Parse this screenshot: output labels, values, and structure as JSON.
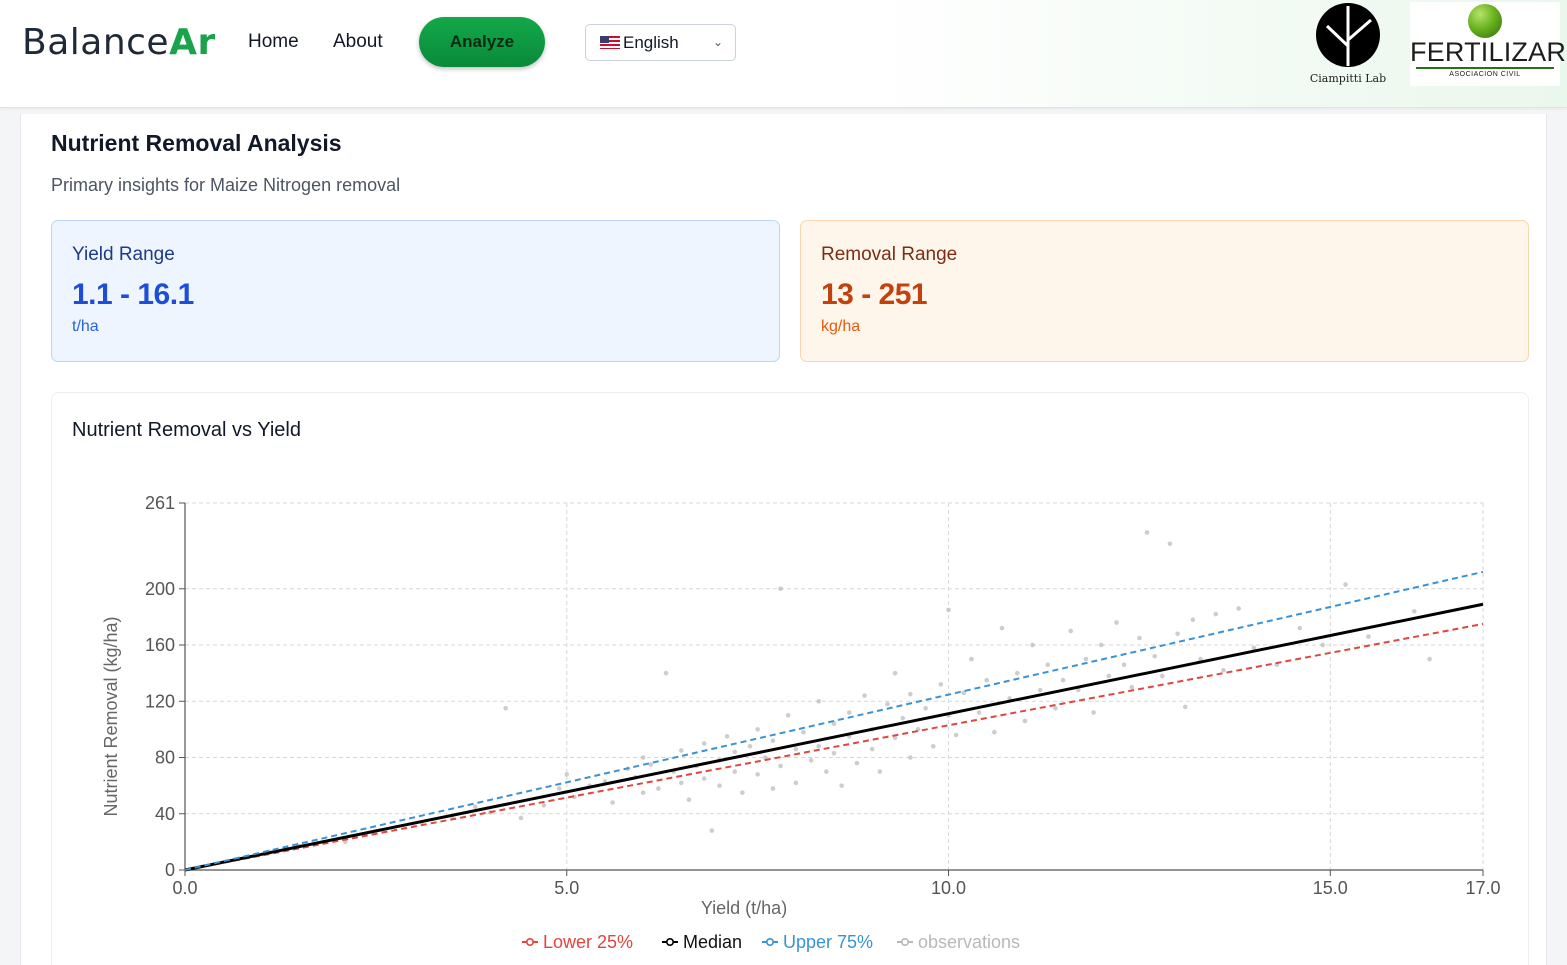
{
  "header": {
    "brand_part1": "Balance",
    "brand_part2": "Ar",
    "nav": {
      "home": "Home",
      "about": "About"
    },
    "analyze_label": "Analyze",
    "language": {
      "selected": "English",
      "flag_icon": "us-flag-icon"
    },
    "partners": {
      "ciampitti": "Ciampitti Lab",
      "fertilizar": "FERTILIZAR",
      "fertilizar_sub": "ASOCIACION CIVIL"
    }
  },
  "page": {
    "title": "Nutrient Removal Analysis",
    "subtitle": "Primary insights for Maize Nitrogen removal"
  },
  "stats": {
    "yield": {
      "label": "Yield Range",
      "value": "1.1 - 16.1",
      "unit": "t/ha"
    },
    "removal": {
      "label": "Removal Range",
      "value": "13 - 251",
      "unit": "kg/ha"
    }
  },
  "chart_title": "Nutrient Removal vs Yield",
  "colors": {
    "lower": "#e0463e",
    "median": "#000000",
    "upper": "#3a92d6",
    "observations": "#b8b8b8"
  },
  "chart_data": {
    "type": "scatter",
    "xlabel": "Yield (t/ha)",
    "ylabel": "Nutrient Removal (kg/ha)",
    "xlim": [
      0,
      17
    ],
    "ylim": [
      0,
      261
    ],
    "x_ticks": [
      0.0,
      5.0,
      10.0,
      15.0,
      17.0
    ],
    "x_tick_labels": [
      "0.0",
      "5.0",
      "10.0",
      "15.0",
      "17.0"
    ],
    "y_ticks": [
      0,
      40,
      80,
      120,
      160,
      200,
      261
    ],
    "y_tick_labels": [
      "0",
      "40",
      "80",
      "120",
      "160",
      "200",
      "261"
    ],
    "grid": true,
    "legend_position": "bottom",
    "series": [
      {
        "name": "Lower 25%",
        "kind": "line",
        "style": "dashed",
        "x": [
          0,
          17
        ],
        "y": [
          0,
          175
        ]
      },
      {
        "name": "Median",
        "kind": "line",
        "style": "solid",
        "x": [
          0,
          17
        ],
        "y": [
          0,
          189
        ]
      },
      {
        "name": "Upper 75%",
        "kind": "line",
        "style": "dashed",
        "x": [
          0,
          17
        ],
        "y": [
          0,
          212
        ]
      },
      {
        "name": "observations",
        "kind": "scatter",
        "points": [
          [
            1.1,
            13
          ],
          [
            1.5,
            17
          ],
          [
            2.1,
            20
          ],
          [
            2.6,
            28
          ],
          [
            3.1,
            34
          ],
          [
            3.5,
            38
          ],
          [
            3.8,
            45
          ],
          [
            4.0,
            41
          ],
          [
            4.2,
            115
          ],
          [
            4.4,
            37
          ],
          [
            4.7,
            46
          ],
          [
            4.9,
            58
          ],
          [
            5.0,
            68
          ],
          [
            5.1,
            52
          ],
          [
            5.3,
            60
          ],
          [
            5.5,
            63
          ],
          [
            5.6,
            48
          ],
          [
            5.8,
            72
          ],
          [
            5.9,
            66
          ],
          [
            6.0,
            55
          ],
          [
            6.0,
            80
          ],
          [
            6.1,
            75
          ],
          [
            6.2,
            58
          ],
          [
            6.3,
            140
          ],
          [
            6.4,
            70
          ],
          [
            6.5,
            62
          ],
          [
            6.5,
            85
          ],
          [
            6.6,
            50
          ],
          [
            6.7,
            74
          ],
          [
            6.8,
            65
          ],
          [
            6.8,
            90
          ],
          [
            6.9,
            28
          ],
          [
            7.0,
            78
          ],
          [
            7.0,
            60
          ],
          [
            7.1,
            95
          ],
          [
            7.2,
            70
          ],
          [
            7.2,
            84
          ],
          [
            7.3,
            55
          ],
          [
            7.4,
            88
          ],
          [
            7.5,
            100
          ],
          [
            7.5,
            68
          ],
          [
            7.6,
            80
          ],
          [
            7.7,
            58
          ],
          [
            7.7,
            92
          ],
          [
            7.8,
            200
          ],
          [
            7.8,
            74
          ],
          [
            7.9,
            110
          ],
          [
            8.0,
            86
          ],
          [
            8.0,
            62
          ],
          [
            8.1,
            98
          ],
          [
            8.2,
            78
          ],
          [
            8.3,
            120
          ],
          [
            8.3,
            88
          ],
          [
            8.4,
            70
          ],
          [
            8.5,
            104
          ],
          [
            8.5,
            83
          ],
          [
            8.6,
            60
          ],
          [
            8.7,
            112
          ],
          [
            8.7,
            95
          ],
          [
            8.8,
            76
          ],
          [
            8.9,
            124
          ],
          [
            9.0,
            100
          ],
          [
            9.0,
            86
          ],
          [
            9.1,
            70
          ],
          [
            9.2,
            118
          ],
          [
            9.3,
            94
          ],
          [
            9.3,
            140
          ],
          [
            9.4,
            108
          ],
          [
            9.5,
            80
          ],
          [
            9.5,
            125
          ],
          [
            9.6,
            100
          ],
          [
            9.7,
            115
          ],
          [
            9.8,
            88
          ],
          [
            9.9,
            132
          ],
          [
            10.0,
            110
          ],
          [
            10.0,
            185
          ],
          [
            10.1,
            96
          ],
          [
            10.2,
            126
          ],
          [
            10.3,
            150
          ],
          [
            10.4,
            112
          ],
          [
            10.5,
            135
          ],
          [
            10.6,
            98
          ],
          [
            10.7,
            172
          ],
          [
            10.8,
            122
          ],
          [
            10.9,
            140
          ],
          [
            11.0,
            106
          ],
          [
            11.1,
            160
          ],
          [
            11.2,
            128
          ],
          [
            11.3,
            146
          ],
          [
            11.4,
            115
          ],
          [
            11.5,
            135
          ],
          [
            11.6,
            170
          ],
          [
            11.7,
            128
          ],
          [
            11.8,
            150
          ],
          [
            11.9,
            112
          ],
          [
            12.0,
            160
          ],
          [
            12.1,
            138
          ],
          [
            12.2,
            176
          ],
          [
            12.3,
            146
          ],
          [
            12.4,
            130
          ],
          [
            12.5,
            165
          ],
          [
            12.6,
            240
          ],
          [
            12.7,
            152
          ],
          [
            12.8,
            138
          ],
          [
            12.9,
            232
          ],
          [
            13.0,
            168
          ],
          [
            13.1,
            116
          ],
          [
            13.2,
            178
          ],
          [
            13.3,
            150
          ],
          [
            13.5,
            182
          ],
          [
            13.6,
            142
          ],
          [
            13.8,
            186
          ],
          [
            14.0,
            158
          ],
          [
            14.3,
            146
          ],
          [
            14.6,
            172
          ],
          [
            14.9,
            160
          ],
          [
            15.2,
            203
          ],
          [
            15.5,
            166
          ],
          [
            16.1,
            184
          ],
          [
            16.3,
            150
          ]
        ]
      }
    ]
  }
}
